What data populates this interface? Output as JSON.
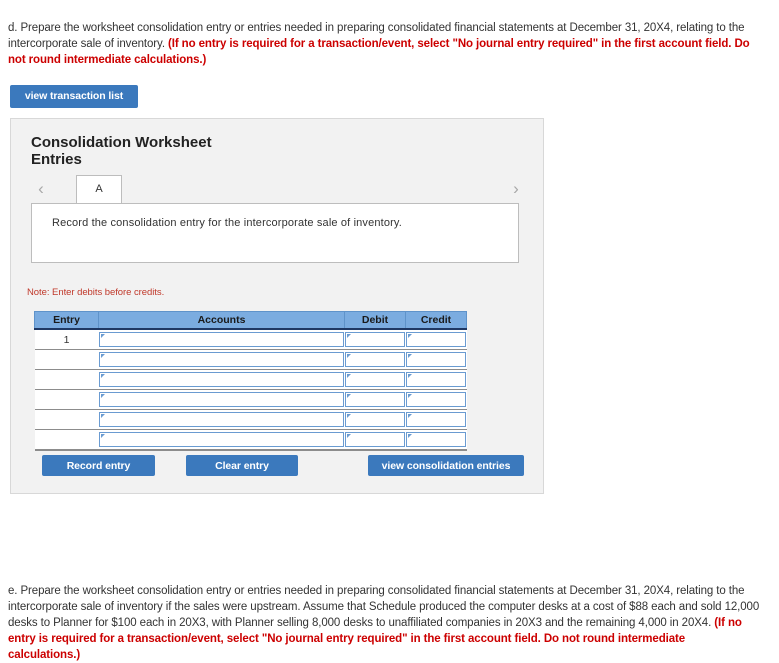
{
  "question_d": {
    "normal_1": "d. Prepare the worksheet consolidation entry or entries needed in preparing consolidated financial statements at December 31, 20X4, relating to the intercorporate sale of inventory. ",
    "emphasis": "(If no entry is required for a transaction/event, select \"No journal entry required\" in the first account field. Do not round intermediate calculations.)"
  },
  "question_e": {
    "normal_1": "e. Prepare the worksheet consolidation entry or entries needed in preparing consolidated financial statements at December 31, 20X4, relating to the intercorporate sale of inventory if the sales were upstream. Assume that Schedule produced the computer desks at a cost of $88 each and sold 12,000 desks to Planner for $100 each in 20X3, with Planner selling 8,000 desks to unaffiliated companies in 20X3 and the remaining 4,000 in 20X4. ",
    "emphasis": "(If no entry is required for a transaction/event, select \"No journal entry required\" in the first account field. Do not round intermediate calculations.)"
  },
  "toolbar": {
    "view_transaction_list_label": "view transaction list"
  },
  "panel": {
    "title": "Consolidation Worksheet Entries",
    "nav_prev_icon": "‹",
    "nav_next_icon": "›",
    "tabs": [
      {
        "label": "A",
        "active": true
      }
    ],
    "instruction": "Record the consolidation entry for the intercorporate sale of inventory.",
    "note": "Note: Enter debits before credits.",
    "table": {
      "headers": [
        "Entry",
        "Accounts",
        "Debit",
        "Credit"
      ],
      "rows": [
        {
          "entry": "1",
          "account": "",
          "debit": "",
          "credit": ""
        },
        {
          "entry": "",
          "account": "",
          "debit": "",
          "credit": ""
        },
        {
          "entry": "",
          "account": "",
          "debit": "",
          "credit": ""
        },
        {
          "entry": "",
          "account": "",
          "debit": "",
          "credit": ""
        },
        {
          "entry": "",
          "account": "",
          "debit": "",
          "credit": ""
        },
        {
          "entry": "",
          "account": "",
          "debit": "",
          "credit": ""
        }
      ]
    },
    "buttons": {
      "record_entry_label": "Record entry",
      "clear_entry_label": "Clear entry",
      "view_consolidation_entries_label": "view consolidation entries"
    }
  },
  "colors": {
    "button_blue": "#3b79bd",
    "table_header_blue": "#7bace0",
    "emphasis_red": "#cc0000",
    "note_red": "#c0392b",
    "panel_gray": "#f2f2f2"
  }
}
